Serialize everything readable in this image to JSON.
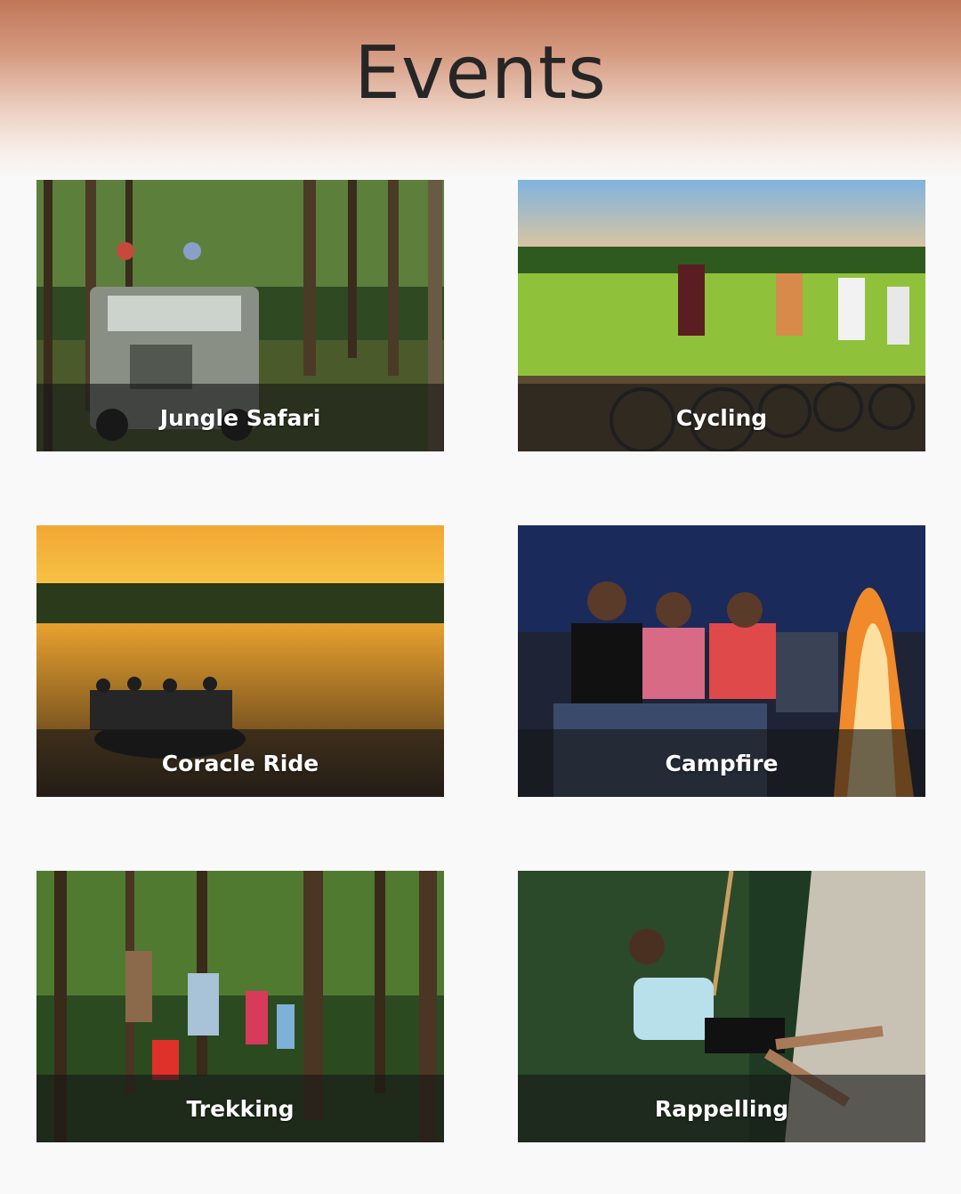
{
  "header": {
    "title": "Events"
  },
  "events": [
    {
      "label": "Jungle Safari"
    },
    {
      "label": "Cycling"
    },
    {
      "label": "Coracle Ride"
    },
    {
      "label": "Campfire"
    },
    {
      "label": "Trekking"
    },
    {
      "label": "Rappelling"
    }
  ]
}
